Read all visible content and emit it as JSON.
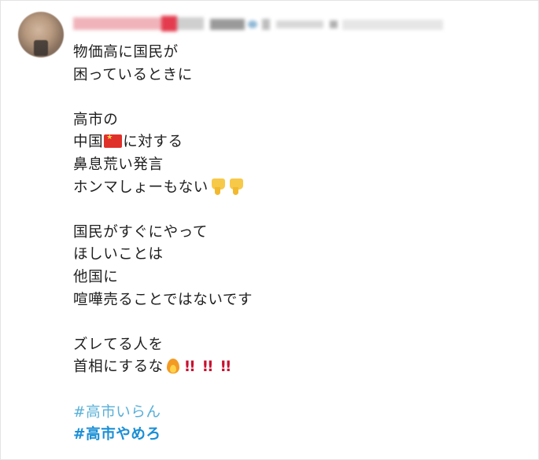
{
  "post": {
    "lines": [
      "物価高に国民が",
      "困っているときに",
      "高市の",
      "中国",
      "に対する",
      "鼻息荒い発言",
      "ホンマしょーもない",
      "国民がすぐにやって",
      "ほしいことは",
      "他国に",
      "喧嘩売ることではないです",
      "ズレてる人を",
      "首相にするな",
      "!!",
      "!!",
      "!!"
    ],
    "hashtags": [
      "#高市いらん",
      "#高市やめろ"
    ]
  },
  "icons": {
    "flag": "china-flag-icon",
    "thumbs": "thumbs-down-icon",
    "fire": "fire-icon",
    "exclaim": "double-exclamation-icon"
  },
  "colors": {
    "text": "#1f1f1f",
    "hashtag": "#1d9bf0",
    "exclaim": "#c8102e"
  }
}
